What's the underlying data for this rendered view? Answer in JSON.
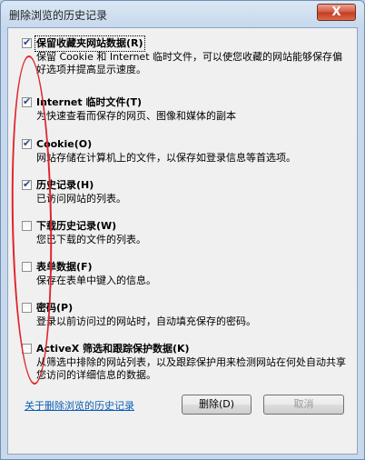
{
  "window": {
    "title": "删除浏览的历史记录",
    "close_label": "X"
  },
  "options": [
    {
      "title": "保留收藏夹网站数据(R)",
      "desc": "保留 Cookie 和 Internet 临时文件，可以使您收藏的网站能够保存偏好选项并提高显示速度。",
      "checked": true
    },
    {
      "title": "Internet 临时文件(T)",
      "desc": "为快速查看而保存的网页、图像和媒体的副本",
      "checked": true
    },
    {
      "title": "Cookie(O)",
      "desc": "网站存储在计算机上的文件，以保存如登录信息等首选项。",
      "checked": true
    },
    {
      "title": "历史记录(H)",
      "desc": "已访问网站的列表。",
      "checked": true
    },
    {
      "title": "下载历史记录(W)",
      "desc": "您已下载的文件的列表。",
      "checked": false
    },
    {
      "title": "表单数据(F)",
      "desc": "保存在表单中键入的信息。",
      "checked": false
    },
    {
      "title": "密码(P)",
      "desc": "登录以前访问过的网站时，自动填充保存的密码。",
      "checked": false
    },
    {
      "title": "ActiveX 筛选和跟踪保护数据(K)",
      "desc": "从筛选中排除的网站列表，以及跟踪保护用来检测网站在何处自动共享您访问的详细信息的数据。",
      "checked": false
    }
  ],
  "check_glyph": "✔",
  "footer": {
    "link": "关于删除浏览的历史记录",
    "delete_label": "删除(D)",
    "cancel_label": "取消"
  },
  "colors": {
    "annotation": "#e0232b",
    "link": "#0b5fb5"
  }
}
